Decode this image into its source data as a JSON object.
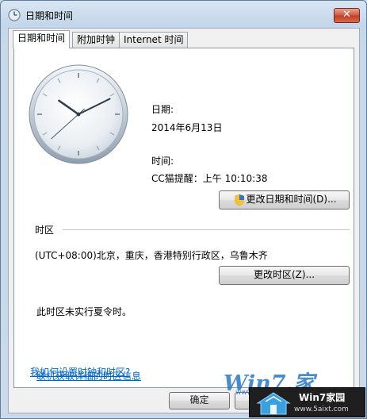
{
  "window": {
    "title": "日期和时间",
    "close_label": "✕"
  },
  "tabs": [
    {
      "label": "日期和时间",
      "active": true
    },
    {
      "label": "附加时钟",
      "active": false
    },
    {
      "label": "Internet 时间",
      "active": false
    }
  ],
  "datetime": {
    "date_label": "日期:",
    "date_value": "2014年6月13日",
    "time_label": "时间:",
    "time_value": "CC猫提醒：上午 10:10:38",
    "change_button": "更改日期和时间(D)..."
  },
  "timezone": {
    "section_label": "时区",
    "value": "(UTC+08:00)北京，重庆，香港特别行政区，乌鲁木齐",
    "change_button": "更改时区(Z)...",
    "dst_note": "此时区未实行夏令时。"
  },
  "links": {
    "online_info": "联机获取详细的时区信息",
    "howto": "我如何设置时钟和时区?"
  },
  "footer": {
    "ok_label": "确定"
  },
  "watermark": {
    "brand": "Win7.家",
    "sub": "www.w",
    "badge_title": "Win7家园",
    "badge_url": "www.5aixt.com"
  },
  "clock": {
    "hour": 10,
    "minute": 10,
    "second": 38
  }
}
